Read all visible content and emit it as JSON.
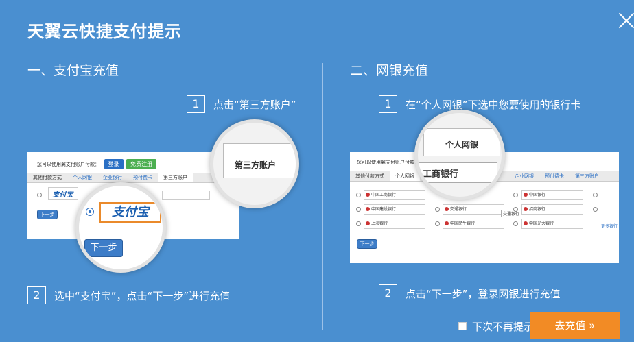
{
  "dialog": {
    "title": "天翼云快捷支付提示"
  },
  "alipay": {
    "section_title": "一、支付宝充值",
    "step1_num": "1",
    "step1_text": "点击“第三方账户”",
    "step2_num": "2",
    "step2_text": "选中“支付宝”，点击“下一步”进行充值",
    "shot": {
      "prompt": "您可以使用翼支付账户付款：",
      "login": "登录",
      "register": "免费注册",
      "tabs": [
        "其他付款方式",
        "个人网银",
        "企业银行",
        "预付费卡",
        "第三方账户"
      ],
      "alipay_logo": "支付宝",
      "next": "下一步"
    },
    "zoom_tab": "第三方账户",
    "zoom_logo": "支付宝",
    "zoom_next": "下一步"
  },
  "netbank": {
    "section_title": "二、网银充值",
    "step1_num": "1",
    "step1_text": "在“个人网银”下选中您要使用的银行卡",
    "step2_num": "2",
    "step2_text": "点击“下一步”，登录网银进行充值",
    "shot": {
      "prompt": "您可以使用翼支付账户付款：",
      "tabs": [
        "其他付款方式",
        "个人网银",
        "企业网银",
        "预付费卡",
        "第三方账户"
      ],
      "banks": [
        "中国工商银行",
        "中国建设银行",
        "上海银行",
        "交通银行",
        "中国民生银行",
        "中国银行",
        "招商银行",
        "中国光大银行"
      ],
      "tooltip": "交通银行",
      "more": "更多银行",
      "next": "下一步"
    },
    "zoom_tab": "个人网银",
    "zoom_bank": "工商银行",
    "zoom_bank_suffix": "银行"
  },
  "footer": {
    "no_remind": "下次不再提示",
    "go_button": "去充值 »"
  }
}
